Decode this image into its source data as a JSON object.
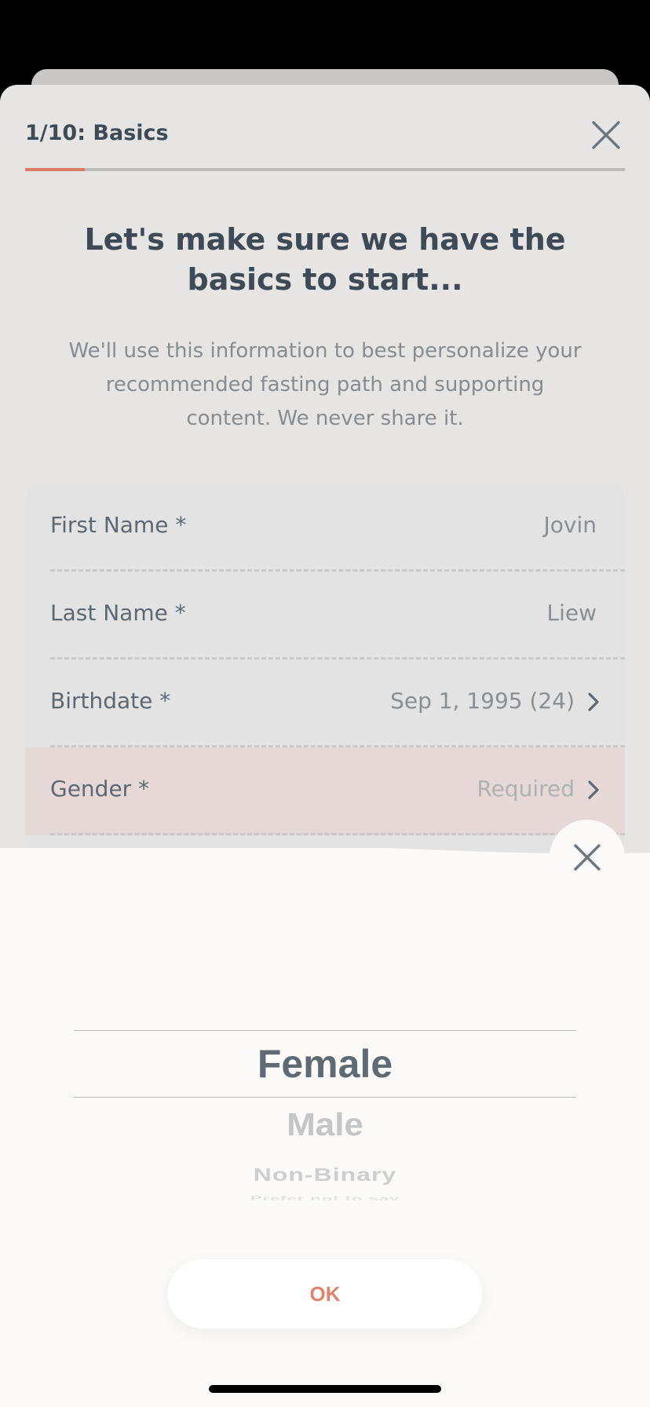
{
  "header": {
    "step_title": "1/10: Basics",
    "progress": 0.1
  },
  "intro": {
    "heading": "Let's make sure we have the basics to start...",
    "subtext": "We'll use this information to best personalize your recommended fasting path and supporting content. We never share it."
  },
  "form": {
    "rows": [
      {
        "label": "First Name *",
        "value": "Jovin"
      },
      {
        "label": "Last Name *",
        "value": "Liew"
      },
      {
        "label": "Birthdate *",
        "value": "Sep 1, 1995 (24)"
      },
      {
        "label": "Gender *",
        "value": "Required"
      }
    ]
  },
  "picker": {
    "options": [
      "Female",
      "Male",
      "Non-Binary",
      "Prefer not to say"
    ],
    "selected": "Female",
    "ok_label": "OK"
  },
  "colors": {
    "accent": "#d97a62",
    "ok_text": "#e2826b",
    "text_dark": "#3e4a56",
    "sheet_bg": "#e6e5e3",
    "picker_bg": "#fbfaf8",
    "highlight_row": "#e7d8d8"
  },
  "icons": [
    "close-icon",
    "chevron-right-icon"
  ]
}
